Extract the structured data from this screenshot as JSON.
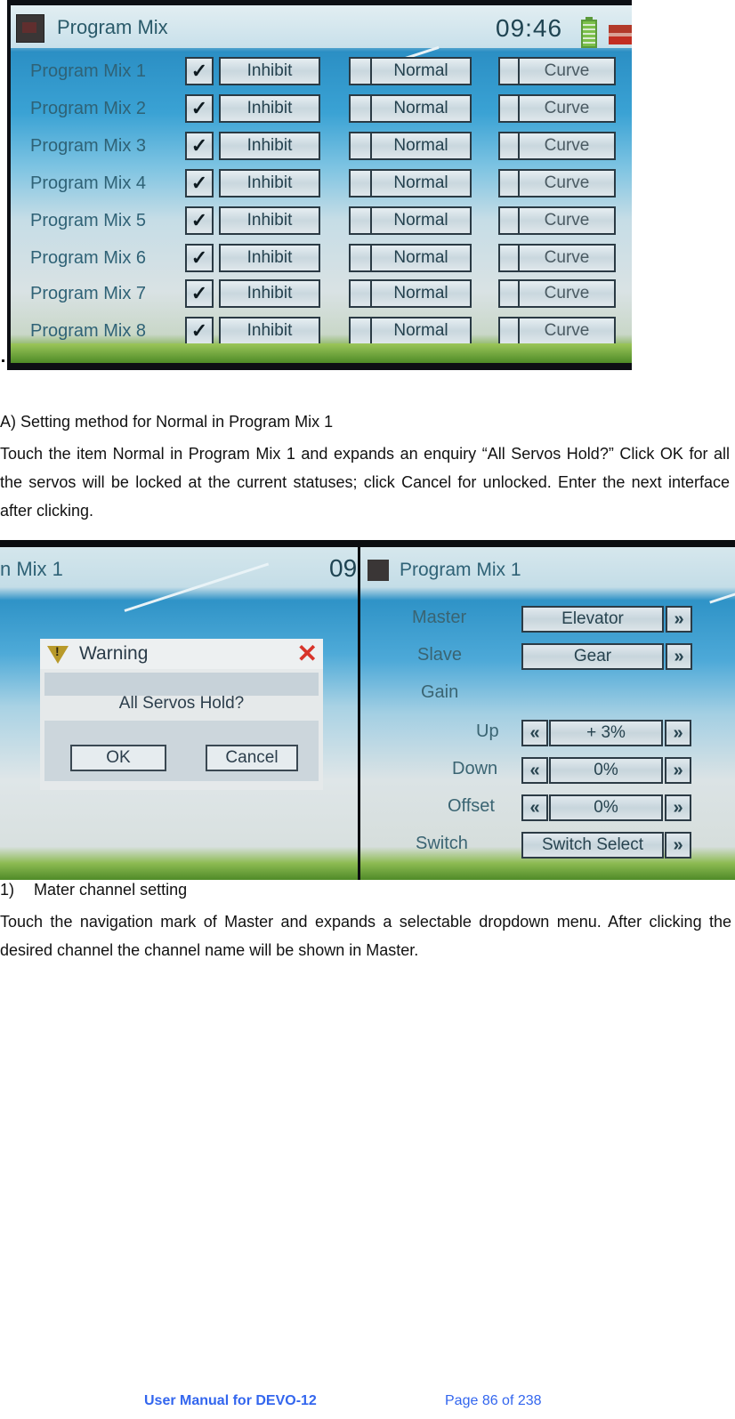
{
  "screen1": {
    "title": "Program Mix",
    "clock": "09:46",
    "rows": [
      {
        "label": "Program Mix 1",
        "check1": "✓",
        "state": "Inhibit",
        "mode": "Normal",
        "curve": "Curve"
      },
      {
        "label": "Program Mix 2",
        "check1": "✓",
        "state": "Inhibit",
        "mode": "Normal",
        "curve": "Curve"
      },
      {
        "label": "Program Mix 3",
        "check1": "✓",
        "state": "Inhibit",
        "mode": "Normal",
        "curve": "Curve"
      },
      {
        "label": "Program Mix 4",
        "check1": "✓",
        "state": "Inhibit",
        "mode": "Normal",
        "curve": "Curve"
      },
      {
        "label": "Program Mix 5",
        "check1": "✓",
        "state": "Inhibit",
        "mode": "Normal",
        "curve": "Curve"
      },
      {
        "label": "Program Mix 6",
        "check1": "✓",
        "state": "Inhibit",
        "mode": "Normal",
        "curve": "Curve"
      },
      {
        "label": "Program Mix 7",
        "check1": "✓",
        "state": "Inhibit",
        "mode": "Normal",
        "curve": "Curve"
      },
      {
        "label": "Program Mix 8",
        "check1": "✓",
        "state": "Inhibit",
        "mode": "Normal",
        "curve": "Curve"
      }
    ]
  },
  "text": {
    "heading_a": "A) Setting method for Normal in Program Mix 1",
    "para1": "Touch the item Normal in Program Mix 1 and expands an enquiry “All Servos Hold?” Click OK for all the servos will be locked at the current statuses; click Cancel for unlocked. Enter the next interface after clicking.",
    "list1_num": "1)",
    "list1_label": "Mater channel setting",
    "para2": "Touch the navigation mark of Master and expands a selectable dropdown menu. After clicking the desired channel the channel name will be shown in Master."
  },
  "screen2": {
    "title_partial": "n Mix 1",
    "clock_partial": "09",
    "dialog": {
      "title": "Warning",
      "close": "✕",
      "message": "All Servos Hold?",
      "ok": "OK",
      "cancel": "Cancel"
    }
  },
  "screen3": {
    "title": "Program Mix 1",
    "master_label": "Master",
    "master_value": "Elevator",
    "slave_label": "Slave",
    "slave_value": "Gear",
    "gain_label": "Gain",
    "up_label": "Up",
    "up_value": "+ 3%",
    "down_label": "Down",
    "down_value": "0%",
    "offset_label": "Offset",
    "offset_value": "0%",
    "switch_label": "Switch",
    "switch_value": "Switch Select",
    "arrow_right": "»",
    "arrow_left": "«"
  },
  "footer": {
    "manual": "User Manual for DEVO-12",
    "page": "Page 86 of 238"
  }
}
